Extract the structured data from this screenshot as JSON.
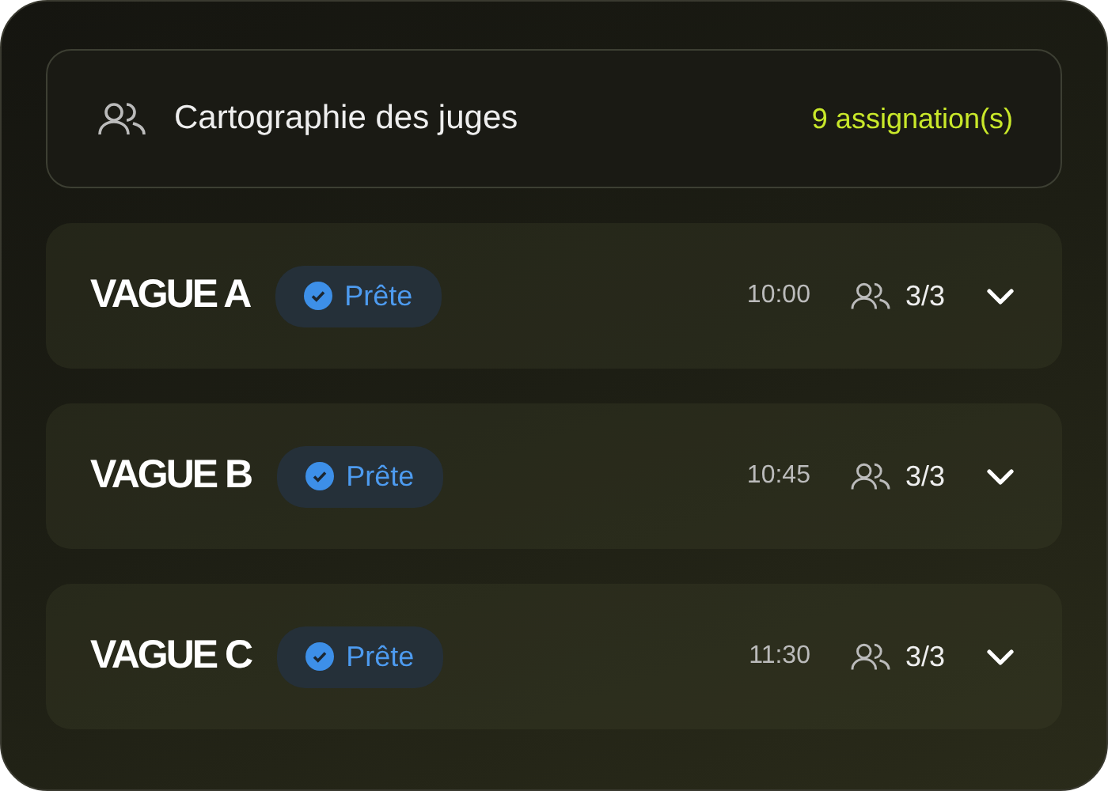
{
  "header": {
    "title": "Cartographie des juges",
    "count": "9 assignation(s)"
  },
  "waves": [
    {
      "name": "VAGUE A",
      "status": {
        "label": "Prête",
        "kind": "ready"
      },
      "time": "10:00",
      "judges": "3/3",
      "expanded": false
    },
    {
      "name": "VAGUE B",
      "status": {
        "label": "Prête",
        "kind": "ready"
      },
      "time": "10:45",
      "judges": "3/3",
      "expanded": false
    },
    {
      "name": "VAGUE C",
      "status": {
        "label": "Prête",
        "kind": "ready"
      },
      "time": "11:30",
      "judges": "3/3",
      "expanded": false
    }
  ]
}
